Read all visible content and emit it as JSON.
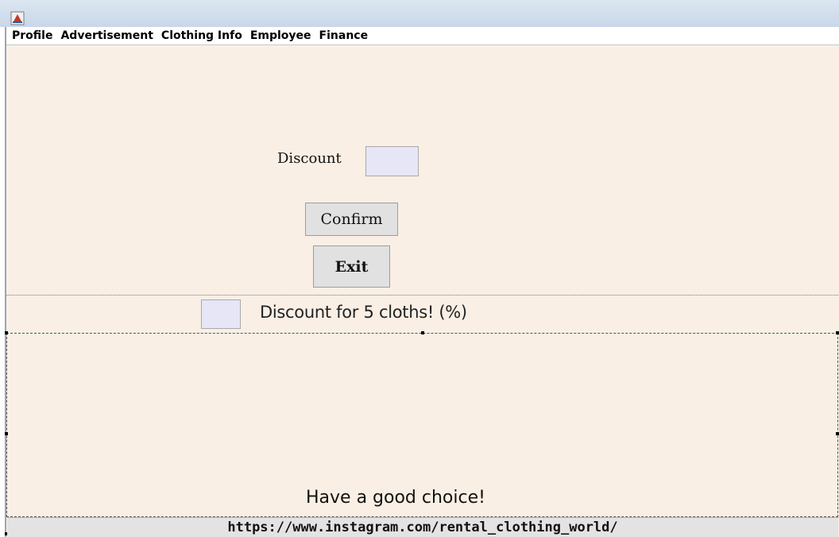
{
  "menu": {
    "items": [
      "Profile",
      "Advertisement",
      "Clothing Info",
      "Employee",
      "Finance"
    ]
  },
  "form": {
    "discount_label": "Discount",
    "discount_value": "",
    "confirm_label": "Confirm",
    "exit_label": "Exit"
  },
  "bulk_discount": {
    "value": "",
    "label": "Discount for 5 cloths! (%)"
  },
  "footer": {
    "message": "Have a good choice!",
    "url": "https://www.instagram.com/rental_clothing_world/"
  },
  "colors": {
    "background": "#f9efe5",
    "field": "#e6e6f7",
    "button": "#e1e1e1",
    "titlebar": "#c9d7e8"
  }
}
